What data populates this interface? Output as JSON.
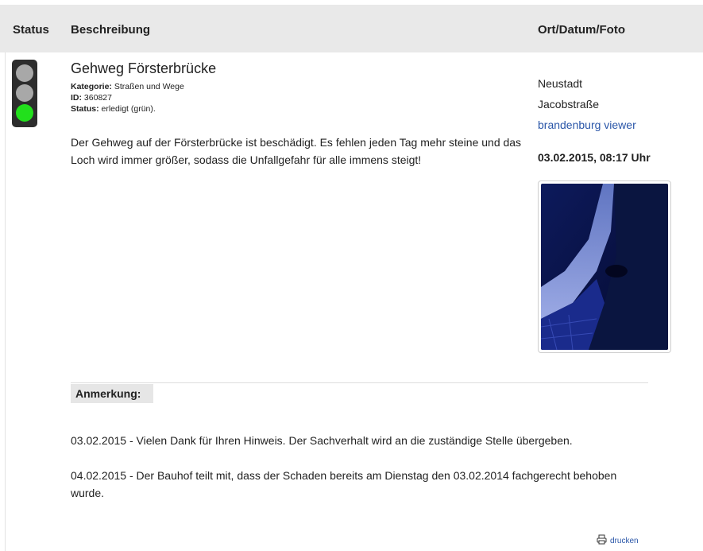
{
  "header": {
    "status": "Status",
    "beschreibung": "Beschreibung",
    "ort": "Ort/Datum/Foto"
  },
  "report": {
    "title": "Gehweg Försterbrücke",
    "kategorie_label": "Kategorie:",
    "kategorie": "Straßen und Wege",
    "id_label": "ID:",
    "id": "360827",
    "status_label": "Status:",
    "status": "erledigt (grün).",
    "traffic_light_state": "green",
    "description": "Der Gehweg auf der Försterbrücke ist beschädigt. Es fehlen jeden Tag mehr steine und das Loch wird immer größer, sodass die Unfallgefahr für alle immens steigt!"
  },
  "location": {
    "city": "Neustadt",
    "street": "Jacobstraße",
    "link": "brandenburg viewer",
    "datetime": "03.02.2015, 08:17 Uhr"
  },
  "notes": {
    "label": "Anmerkung:",
    "items": [
      "03.02.2015 - Vielen Dank für Ihren Hinweis. Der Sachverhalt wird an die zuständige Stelle übergeben.",
      "04.02.2015 - Der Bauhof teilt mit, dass der Schaden bereits am Dienstag den 03.02.2014 fachgerecht behoben wurde."
    ]
  },
  "footer": {
    "print_label": "drucken",
    "print_icon": "printer-icon"
  },
  "colors": {
    "link": "#2a56a8",
    "header_bg": "#e9e9e9",
    "light_green": "#22e01c",
    "light_off": "#a8a8a8"
  }
}
